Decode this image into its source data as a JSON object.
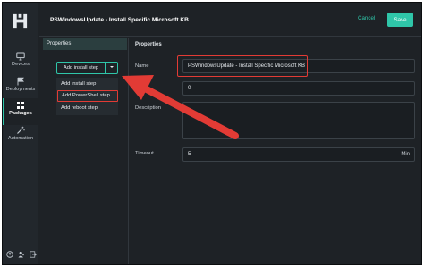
{
  "header": {
    "title": "PSWindowsUpdate - Install Specific Microsoft KB",
    "cancel_label": "Cancel",
    "save_label": "Save"
  },
  "nav": {
    "items": [
      {
        "label": "Devices",
        "icon": "monitor-icon"
      },
      {
        "label": "Deployments",
        "icon": "flag-icon"
      },
      {
        "label": "Packages",
        "icon": "grid-icon"
      },
      {
        "label": "Automation",
        "icon": "wand-icon"
      }
    ],
    "active": "Packages"
  },
  "left_panel": {
    "heading": "Properties",
    "add_button_label": "Add install step",
    "menu": [
      "Add install step",
      "Add PowerShell step",
      "Add reboot step"
    ],
    "highlighted_item": "Add PowerShell step"
  },
  "properties": {
    "heading": "Properties",
    "name_label": "Name",
    "name_value": "PSWindowsUpdate - Install Specific Microsoft KB",
    "order_value": "0",
    "description_label": "Description",
    "description_value": "",
    "timeout_label": "Timeout",
    "timeout_value": "5",
    "timeout_unit": "Min"
  },
  "colors": {
    "accent": "#2fc6a9",
    "highlight": "#e23b35",
    "background": "#1e2226"
  }
}
